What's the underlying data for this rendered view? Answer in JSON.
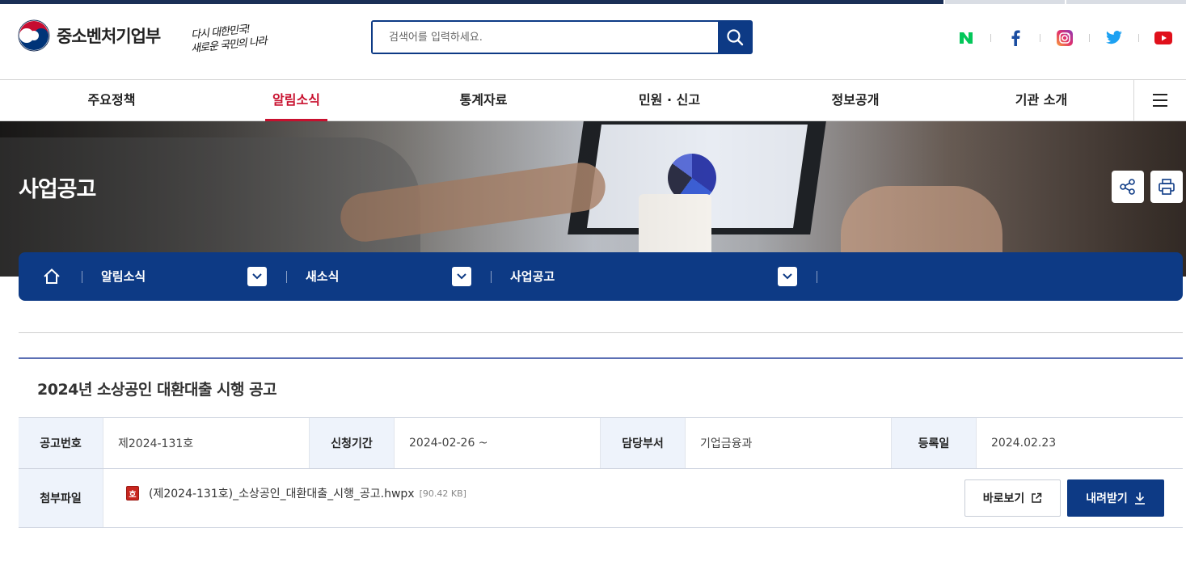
{
  "header": {
    "logo_text": "중소벤처기업부",
    "slogan_line1": "다시 대한민국!",
    "slogan_line2": "새로운 국민의 나라",
    "search_placeholder": "검색어를 입력하세요."
  },
  "sns": [
    "naver-blog-icon",
    "facebook-icon",
    "instagram-icon",
    "twitter-icon",
    "youtube-icon"
  ],
  "gnb": {
    "items": [
      {
        "label": "주요정책"
      },
      {
        "label": "알림소식",
        "active": true
      },
      {
        "label": "통계자료"
      },
      {
        "label": "민원 · 신고"
      },
      {
        "label": "정보공개"
      },
      {
        "label": "기관 소개"
      }
    ]
  },
  "visual": {
    "page_title": "사업공고"
  },
  "location": {
    "crumbs": [
      "알림소식",
      "새소식",
      "사업공고"
    ]
  },
  "post": {
    "title": "2024년 소상공인 대환대출 시행 공고",
    "labels": {
      "number": "공고번호",
      "period": "신청기간",
      "dept": "담당부서",
      "date": "등록일",
      "file": "첨부파일"
    },
    "number": "제2024-131호",
    "period": "2024-02-26 ~",
    "dept": "기업금융과",
    "date": "2024.02.23",
    "file_name": "(제2024-131호)_소상공인_대환대출_시행_공고.hwpx",
    "file_size": "[90.42 KB]",
    "file_icon_glyph": "호",
    "view_label": "바로보기",
    "download_label": "내려받기"
  },
  "colors": {
    "primary": "#0d3a85",
    "active": "#c8102e",
    "th_bg": "#eef3fb"
  }
}
